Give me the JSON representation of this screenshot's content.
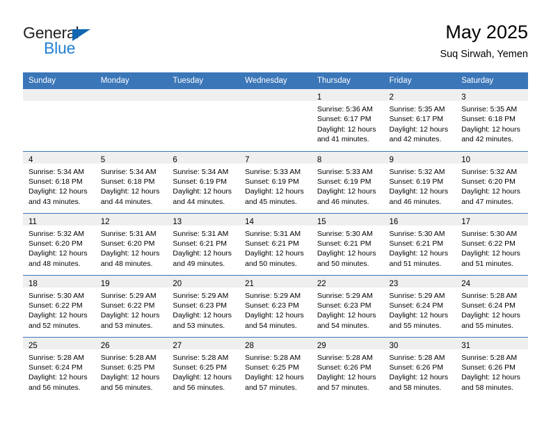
{
  "brand": {
    "name_top": "General",
    "name_bottom": "Blue",
    "color_dark": "#231f20",
    "color_blue": "#1f7fd4",
    "triangle_color": "#1266b0"
  },
  "header": {
    "title": "May 2025",
    "subtitle": "Suq Sirwah, Yemen",
    "accent_color": "#3a76b8",
    "band_color": "#efefef"
  },
  "weekday_headers": [
    "Sunday",
    "Monday",
    "Tuesday",
    "Wednesday",
    "Thursday",
    "Friday",
    "Saturday"
  ],
  "weeks": [
    [
      {
        "empty": true
      },
      {
        "empty": true
      },
      {
        "empty": true
      },
      {
        "empty": true
      },
      {
        "day": "1",
        "sunrise": "Sunrise: 5:36 AM",
        "sunset": "Sunset: 6:17 PM",
        "daylight1": "Daylight: 12 hours",
        "daylight2": "and 41 minutes."
      },
      {
        "day": "2",
        "sunrise": "Sunrise: 5:35 AM",
        "sunset": "Sunset: 6:17 PM",
        "daylight1": "Daylight: 12 hours",
        "daylight2": "and 42 minutes."
      },
      {
        "day": "3",
        "sunrise": "Sunrise: 5:35 AM",
        "sunset": "Sunset: 6:18 PM",
        "daylight1": "Daylight: 12 hours",
        "daylight2": "and 42 minutes."
      }
    ],
    [
      {
        "day": "4",
        "sunrise": "Sunrise: 5:34 AM",
        "sunset": "Sunset: 6:18 PM",
        "daylight1": "Daylight: 12 hours",
        "daylight2": "and 43 minutes."
      },
      {
        "day": "5",
        "sunrise": "Sunrise: 5:34 AM",
        "sunset": "Sunset: 6:18 PM",
        "daylight1": "Daylight: 12 hours",
        "daylight2": "and 44 minutes."
      },
      {
        "day": "6",
        "sunrise": "Sunrise: 5:34 AM",
        "sunset": "Sunset: 6:19 PM",
        "daylight1": "Daylight: 12 hours",
        "daylight2": "and 44 minutes."
      },
      {
        "day": "7",
        "sunrise": "Sunrise: 5:33 AM",
        "sunset": "Sunset: 6:19 PM",
        "daylight1": "Daylight: 12 hours",
        "daylight2": "and 45 minutes."
      },
      {
        "day": "8",
        "sunrise": "Sunrise: 5:33 AM",
        "sunset": "Sunset: 6:19 PM",
        "daylight1": "Daylight: 12 hours",
        "daylight2": "and 46 minutes."
      },
      {
        "day": "9",
        "sunrise": "Sunrise: 5:32 AM",
        "sunset": "Sunset: 6:19 PM",
        "daylight1": "Daylight: 12 hours",
        "daylight2": "and 46 minutes."
      },
      {
        "day": "10",
        "sunrise": "Sunrise: 5:32 AM",
        "sunset": "Sunset: 6:20 PM",
        "daylight1": "Daylight: 12 hours",
        "daylight2": "and 47 minutes."
      }
    ],
    [
      {
        "day": "11",
        "sunrise": "Sunrise: 5:32 AM",
        "sunset": "Sunset: 6:20 PM",
        "daylight1": "Daylight: 12 hours",
        "daylight2": "and 48 minutes."
      },
      {
        "day": "12",
        "sunrise": "Sunrise: 5:31 AM",
        "sunset": "Sunset: 6:20 PM",
        "daylight1": "Daylight: 12 hours",
        "daylight2": "and 48 minutes."
      },
      {
        "day": "13",
        "sunrise": "Sunrise: 5:31 AM",
        "sunset": "Sunset: 6:21 PM",
        "daylight1": "Daylight: 12 hours",
        "daylight2": "and 49 minutes."
      },
      {
        "day": "14",
        "sunrise": "Sunrise: 5:31 AM",
        "sunset": "Sunset: 6:21 PM",
        "daylight1": "Daylight: 12 hours",
        "daylight2": "and 50 minutes."
      },
      {
        "day": "15",
        "sunrise": "Sunrise: 5:30 AM",
        "sunset": "Sunset: 6:21 PM",
        "daylight1": "Daylight: 12 hours",
        "daylight2": "and 50 minutes."
      },
      {
        "day": "16",
        "sunrise": "Sunrise: 5:30 AM",
        "sunset": "Sunset: 6:21 PM",
        "daylight1": "Daylight: 12 hours",
        "daylight2": "and 51 minutes."
      },
      {
        "day": "17",
        "sunrise": "Sunrise: 5:30 AM",
        "sunset": "Sunset: 6:22 PM",
        "daylight1": "Daylight: 12 hours",
        "daylight2": "and 51 minutes."
      }
    ],
    [
      {
        "day": "18",
        "sunrise": "Sunrise: 5:30 AM",
        "sunset": "Sunset: 6:22 PM",
        "daylight1": "Daylight: 12 hours",
        "daylight2": "and 52 minutes."
      },
      {
        "day": "19",
        "sunrise": "Sunrise: 5:29 AM",
        "sunset": "Sunset: 6:22 PM",
        "daylight1": "Daylight: 12 hours",
        "daylight2": "and 53 minutes."
      },
      {
        "day": "20",
        "sunrise": "Sunrise: 5:29 AM",
        "sunset": "Sunset: 6:23 PM",
        "daylight1": "Daylight: 12 hours",
        "daylight2": "and 53 minutes."
      },
      {
        "day": "21",
        "sunrise": "Sunrise: 5:29 AM",
        "sunset": "Sunset: 6:23 PM",
        "daylight1": "Daylight: 12 hours",
        "daylight2": "and 54 minutes."
      },
      {
        "day": "22",
        "sunrise": "Sunrise: 5:29 AM",
        "sunset": "Sunset: 6:23 PM",
        "daylight1": "Daylight: 12 hours",
        "daylight2": "and 54 minutes."
      },
      {
        "day": "23",
        "sunrise": "Sunrise: 5:29 AM",
        "sunset": "Sunset: 6:24 PM",
        "daylight1": "Daylight: 12 hours",
        "daylight2": "and 55 minutes."
      },
      {
        "day": "24",
        "sunrise": "Sunrise: 5:28 AM",
        "sunset": "Sunset: 6:24 PM",
        "daylight1": "Daylight: 12 hours",
        "daylight2": "and 55 minutes."
      }
    ],
    [
      {
        "day": "25",
        "sunrise": "Sunrise: 5:28 AM",
        "sunset": "Sunset: 6:24 PM",
        "daylight1": "Daylight: 12 hours",
        "daylight2": "and 56 minutes."
      },
      {
        "day": "26",
        "sunrise": "Sunrise: 5:28 AM",
        "sunset": "Sunset: 6:25 PM",
        "daylight1": "Daylight: 12 hours",
        "daylight2": "and 56 minutes."
      },
      {
        "day": "27",
        "sunrise": "Sunrise: 5:28 AM",
        "sunset": "Sunset: 6:25 PM",
        "daylight1": "Daylight: 12 hours",
        "daylight2": "and 56 minutes."
      },
      {
        "day": "28",
        "sunrise": "Sunrise: 5:28 AM",
        "sunset": "Sunset: 6:25 PM",
        "daylight1": "Daylight: 12 hours",
        "daylight2": "and 57 minutes."
      },
      {
        "day": "29",
        "sunrise": "Sunrise: 5:28 AM",
        "sunset": "Sunset: 6:26 PM",
        "daylight1": "Daylight: 12 hours",
        "daylight2": "and 57 minutes."
      },
      {
        "day": "30",
        "sunrise": "Sunrise: 5:28 AM",
        "sunset": "Sunset: 6:26 PM",
        "daylight1": "Daylight: 12 hours",
        "daylight2": "and 58 minutes."
      },
      {
        "day": "31",
        "sunrise": "Sunrise: 5:28 AM",
        "sunset": "Sunset: 6:26 PM",
        "daylight1": "Daylight: 12 hours",
        "daylight2": "and 58 minutes."
      }
    ]
  ]
}
